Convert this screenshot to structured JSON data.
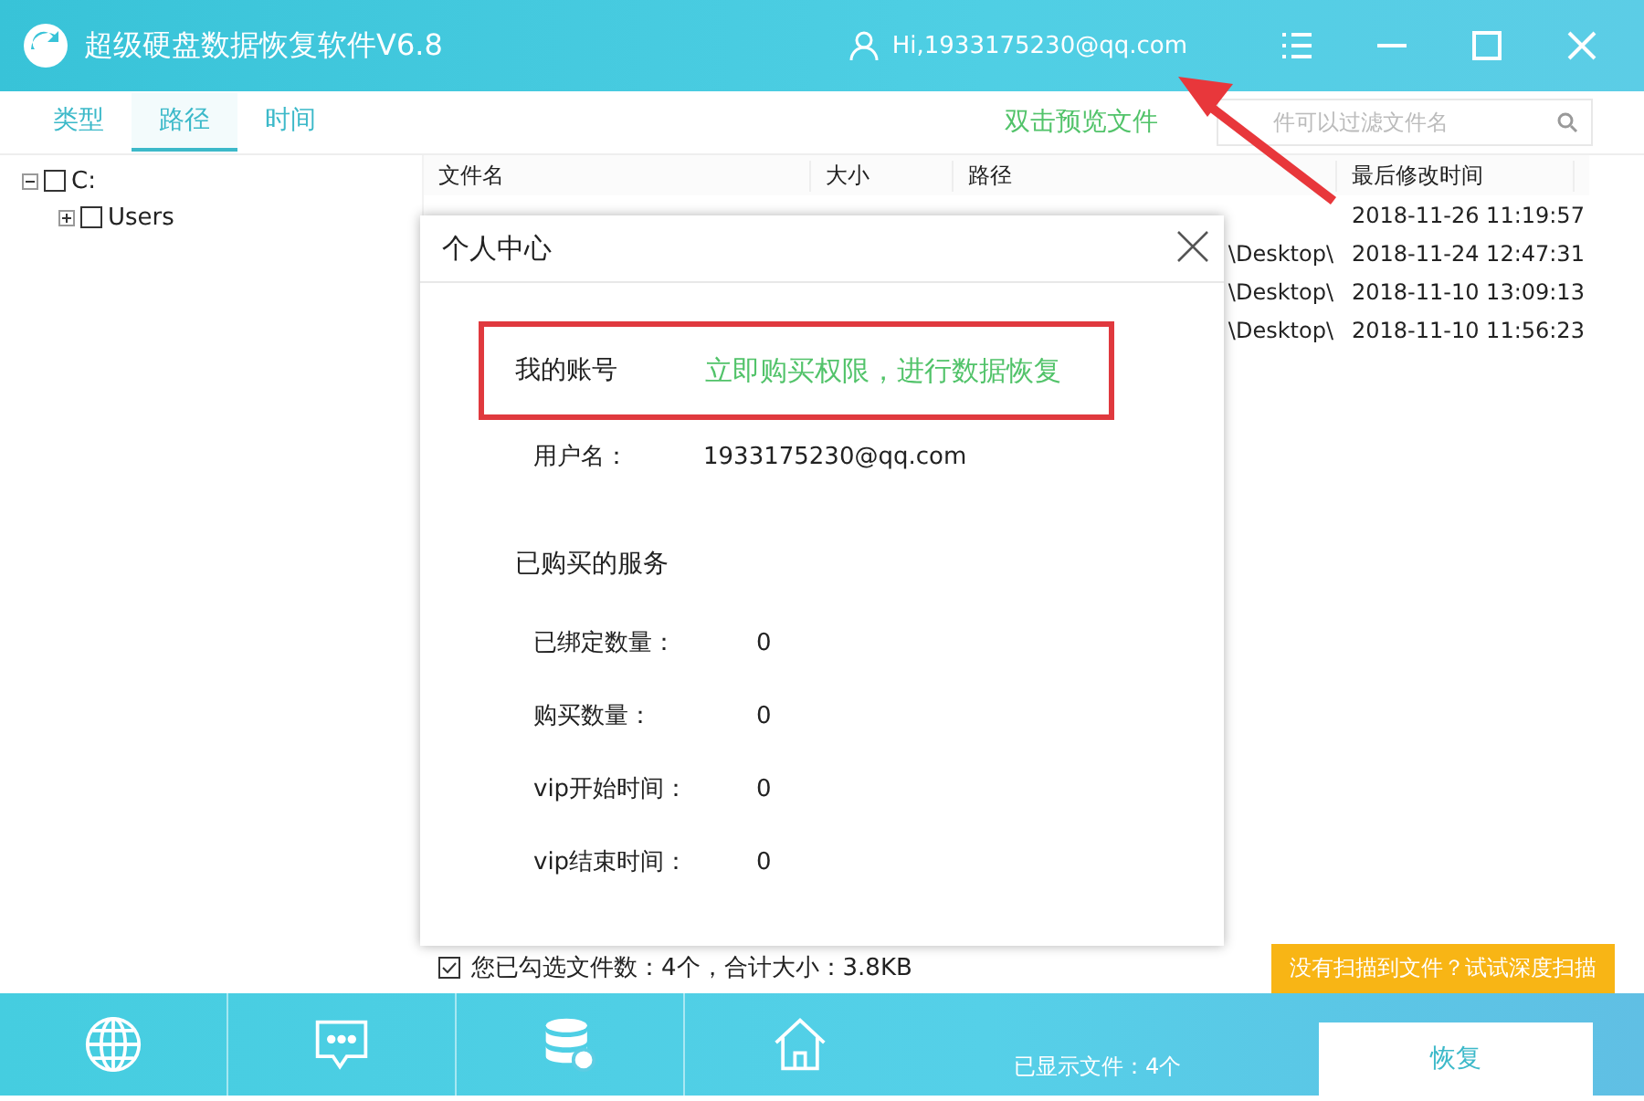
{
  "window": {
    "title": "超级硬盘数据恢复软件V6.8",
    "user": "Hi,1933175230@qq.com"
  },
  "tabs": [
    {
      "label": "类型",
      "selected": false
    },
    {
      "label": "路径",
      "selected": true
    },
    {
      "label": "时间",
      "selected": false
    }
  ],
  "preview_link": "双击预览文件",
  "search": {
    "placeholder": "件可以过滤文件名"
  },
  "tree": [
    {
      "label": "C:",
      "checked": false,
      "expanded": true,
      "children": [
        {
          "label": "Users",
          "checked": false,
          "expanded": false
        }
      ]
    }
  ],
  "table": {
    "columns": [
      "文件名",
      "大小",
      "路径",
      "最后修改时间"
    ],
    "rows": [
      {
        "modified": "2018-11-26 11:19:57"
      },
      {
        "path": "\\Desktop\\",
        "modified": "2018-11-24 12:47:31"
      },
      {
        "path": "\\Desktop\\",
        "modified": "2018-11-10 13:09:13"
      },
      {
        "path": "\\Desktop\\",
        "modified": "2018-11-10 11:56:23"
      }
    ]
  },
  "dialog": {
    "title": "个人中心",
    "account_label": "我的账号",
    "account_link": "立即购买权限，进行数据恢复",
    "username_label": "用户名：",
    "username": "1933175230@qq.com",
    "services_title": "已购买的服务",
    "services": [
      {
        "label": "已绑定数量：",
        "value": "0"
      },
      {
        "label": "购买数量：",
        "value": "0"
      },
      {
        "label": "vip开始时间：",
        "value": "0"
      },
      {
        "label": "vip结束时间：",
        "value": "0"
      }
    ]
  },
  "selection": {
    "checked": true,
    "text": "您已勾选文件数：4个，合计大小：3.8KB"
  },
  "deep_scan_button": "没有扫描到文件？试试深度扫描",
  "bottom_bar": {
    "tools": [
      {
        "kind": "globe"
      },
      {
        "kind": "chat"
      },
      {
        "kind": "database"
      },
      {
        "kind": "home"
      }
    ],
    "shown_count": "已显示文件：4个",
    "recover_button": "恢复"
  }
}
